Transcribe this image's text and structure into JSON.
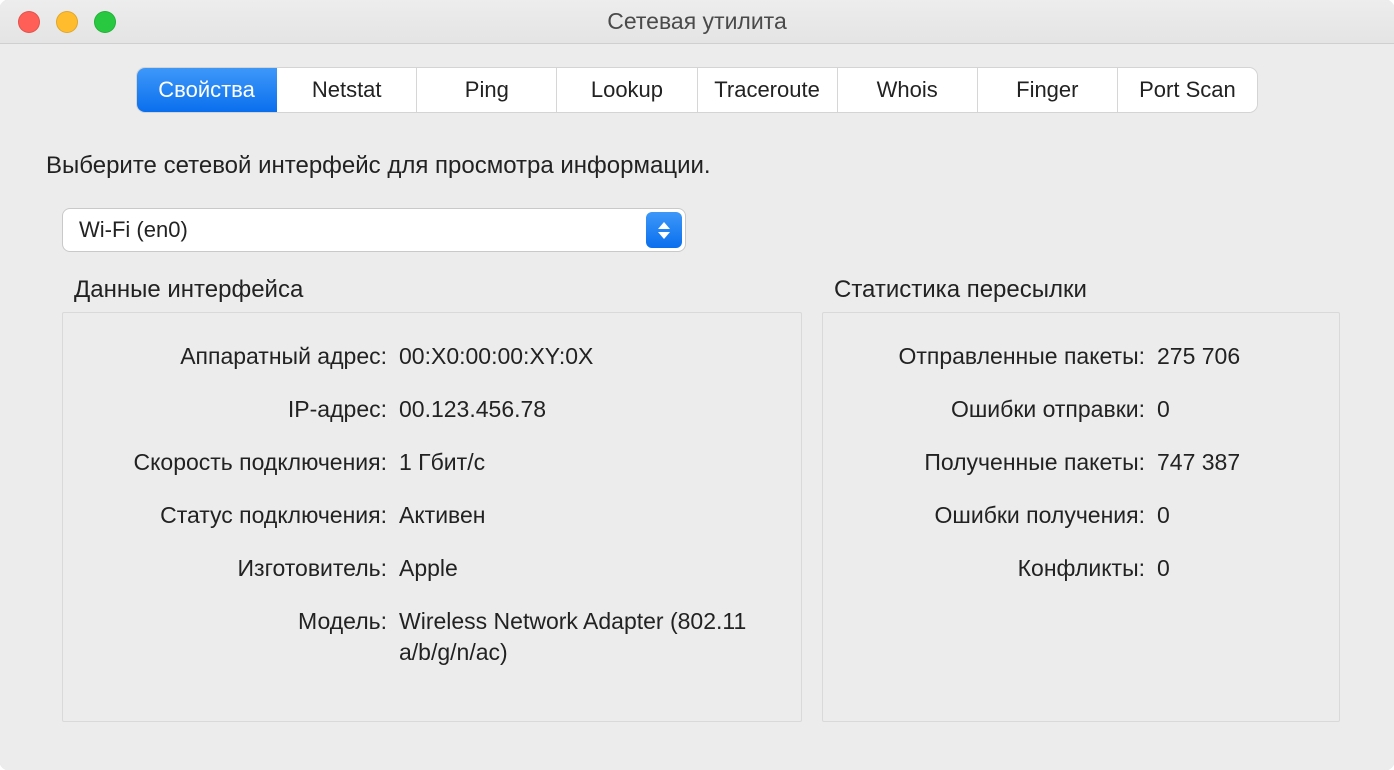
{
  "window": {
    "title": "Сетевая утилита"
  },
  "tabs": [
    {
      "label": "Свойства",
      "active": true
    },
    {
      "label": "Netstat"
    },
    {
      "label": "Ping"
    },
    {
      "label": "Lookup"
    },
    {
      "label": "Traceroute"
    },
    {
      "label": "Whois"
    },
    {
      "label": "Finger"
    },
    {
      "label": "Port Scan"
    }
  ],
  "prompt": "Выберите сетевой интерфейс для просмотра информации.",
  "interface_select": {
    "value": "Wi-Fi (en0)"
  },
  "info_panel": {
    "title": "Данные интерфейса",
    "hardware_address_label": "Аппаратный адрес:",
    "hardware_address": "00:X0:00:00:XY:0X",
    "ip_address_label": "IP-адрес:",
    "ip_address": "00.123.456.78",
    "link_speed_label": "Скорость подключения:",
    "link_speed": "1 Гбит/с",
    "link_status_label": "Статус подключения:",
    "link_status": "Активен",
    "vendor_label": "Изготовитель:",
    "vendor": "Apple",
    "model_label": "Модель:",
    "model": "Wireless Network Adapter (802.11 a/b/g/n/ac)"
  },
  "stats_panel": {
    "title": "Статистика пересылки",
    "sent_packets_label": "Отправленные пакеты:",
    "sent_packets": "275 706",
    "send_errors_label": "Ошибки отправки:",
    "send_errors": "0",
    "recv_packets_label": "Полученные пакеты:",
    "recv_packets": "747 387",
    "recv_errors_label": "Ошибки получения:",
    "recv_errors": "0",
    "collisions_label": "Конфликты:",
    "collisions": "0"
  }
}
